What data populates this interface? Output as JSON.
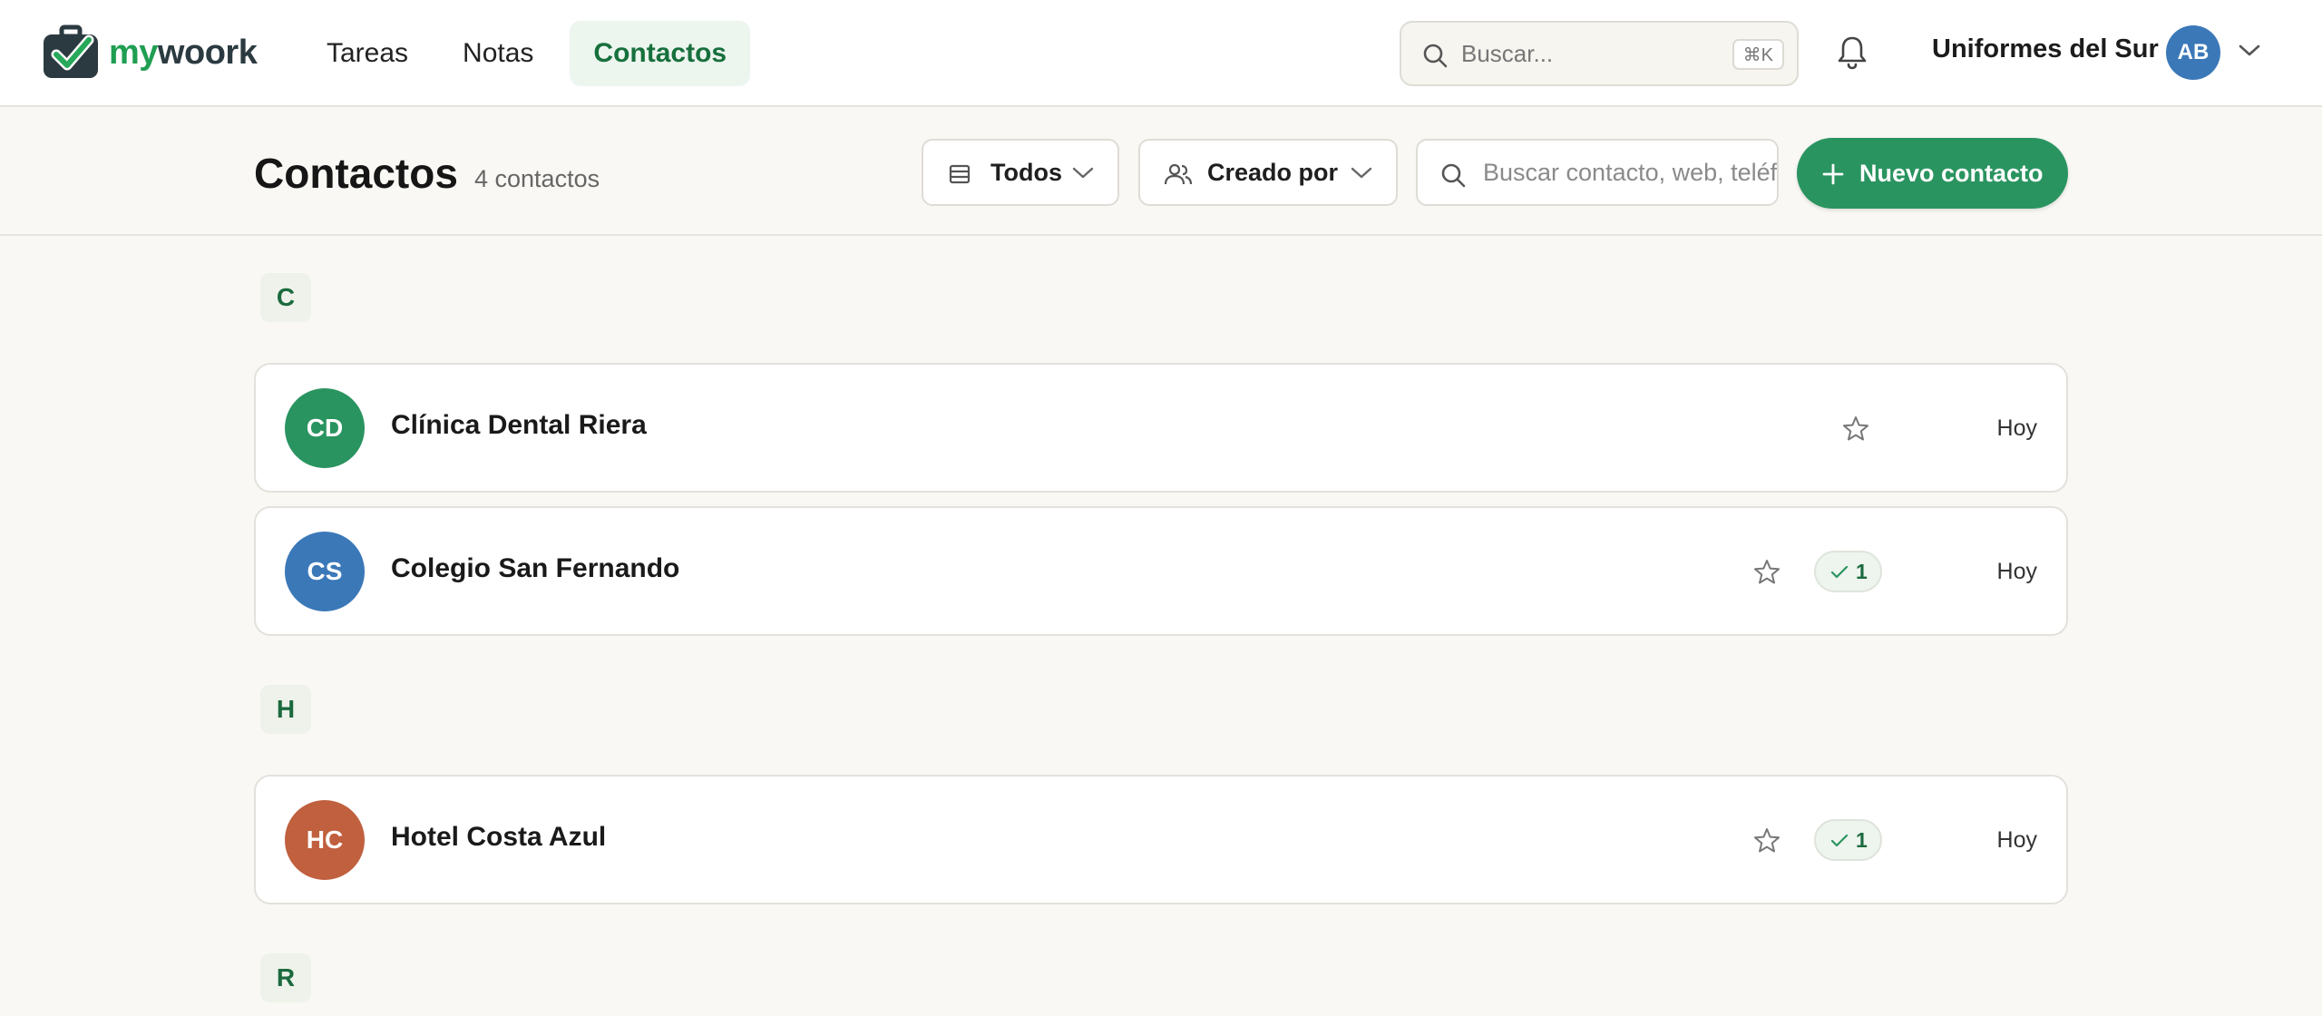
{
  "app": {
    "logo_part1": "my",
    "logo_part2": "woork"
  },
  "nav": [
    {
      "label": "Tareas",
      "active": false
    },
    {
      "label": "Notas",
      "active": false
    },
    {
      "label": "Contactos",
      "active": true
    }
  ],
  "global_search": {
    "placeholder": "Buscar...",
    "shortcut": "⌘K"
  },
  "account": {
    "org_name": "Uniformes del Sur",
    "initials": "AB",
    "avatar_color": "#3b78b8"
  },
  "page": {
    "title": "Contactos",
    "count_label": "4 contactos",
    "filter_type": "Todos",
    "filter_creator": "Creado por",
    "search_placeholder": "Buscar contacto, web, teléfono...",
    "new_button_label": "Nuevo contacto"
  },
  "colors": {
    "brand_green": "#2a9460",
    "accent_text": "#17703c"
  },
  "groups": [
    {
      "letter": "C",
      "contacts": [
        {
          "initials": "CD",
          "name": "Clínica Dental Riera",
          "avatar_color": "#2a9460",
          "task_count": null,
          "date": "Hoy"
        },
        {
          "initials": "CS",
          "name": "Colegio San Fernando",
          "avatar_color": "#3b78b8",
          "task_count": "1",
          "date": "Hoy"
        }
      ]
    },
    {
      "letter": "H",
      "contacts": [
        {
          "initials": "HC",
          "name": "Hotel Costa Azul",
          "avatar_color": "#c0603e",
          "task_count": "1",
          "date": "Hoy"
        }
      ]
    },
    {
      "letter": "R",
      "contacts": []
    }
  ]
}
